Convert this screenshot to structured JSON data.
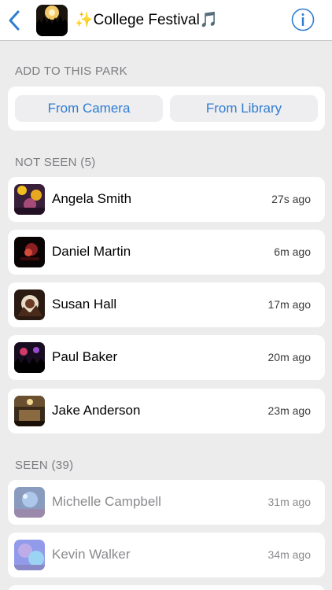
{
  "header": {
    "title": "✨College Festival🎵",
    "back_icon": "chevron-left-icon",
    "info_icon": "info-circle-icon",
    "accent_color": "#2f7dd0"
  },
  "add_section": {
    "title": "ADD TO THIS PARK",
    "from_camera": "From Camera",
    "from_library": "From Library"
  },
  "not_seen": {
    "title": "NOT SEEN (5)",
    "items": [
      {
        "name": "Angela Smith",
        "time": "27s ago"
      },
      {
        "name": "Daniel Martin",
        "time": "6m ago"
      },
      {
        "name": "Susan Hall",
        "time": "17m ago"
      },
      {
        "name": "Paul Baker",
        "time": "20m ago"
      },
      {
        "name": "Jake Anderson",
        "time": "23m ago"
      }
    ]
  },
  "seen": {
    "title": "SEEN (39)",
    "items": [
      {
        "name": "Michelle Campbell",
        "time": "31m ago"
      },
      {
        "name": "Kevin Walker",
        "time": "34m ago"
      }
    ]
  }
}
